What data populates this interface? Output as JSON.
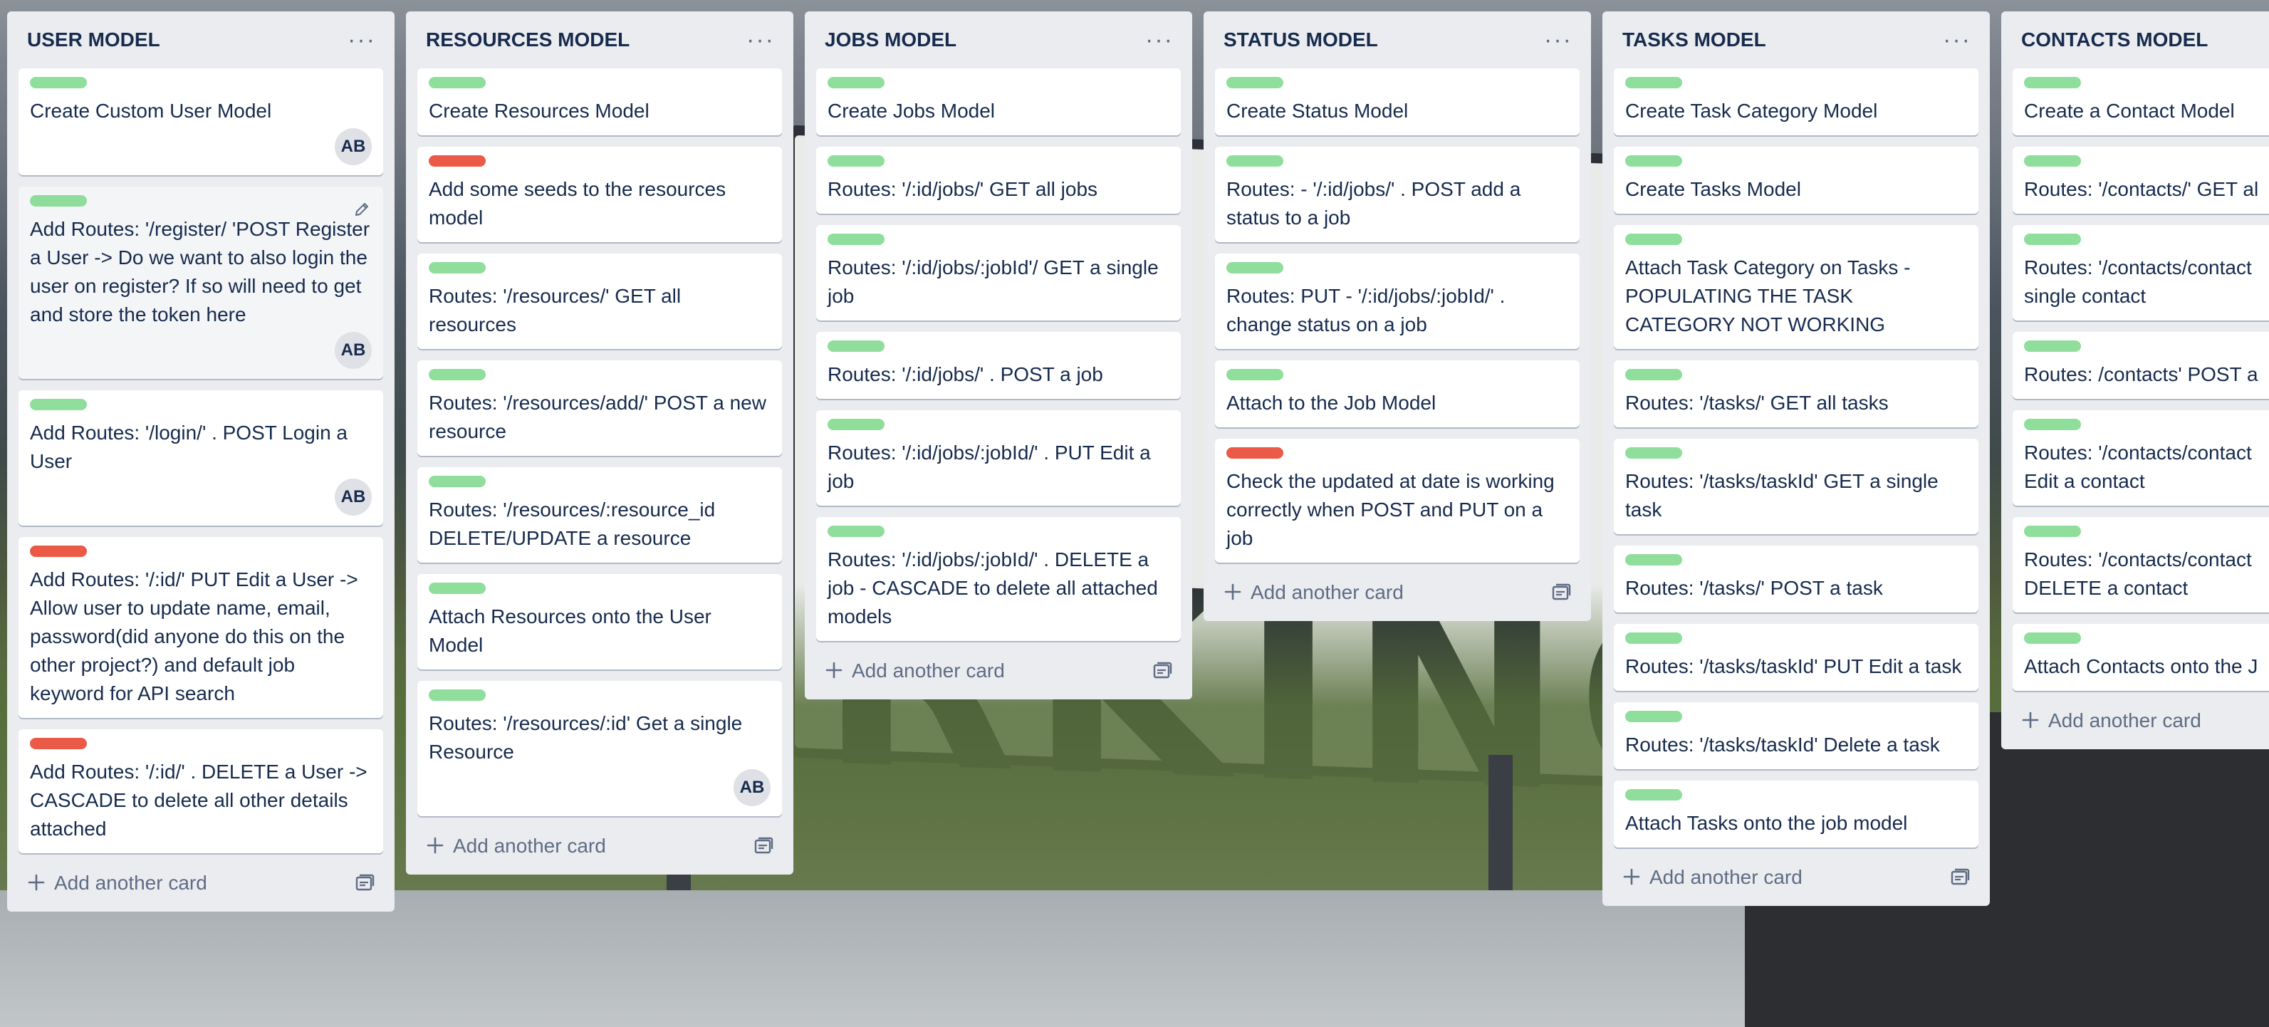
{
  "colors": {
    "label_green": "#7bd88a",
    "label_red": "#eb5a46",
    "list_bg": "#ebecf0"
  },
  "add_card_label": "Add another card",
  "lists": [
    {
      "title": "USER MODEL",
      "cards": [
        {
          "label": "green",
          "title": "Create Custom User Model",
          "member": "AB"
        },
        {
          "label": "green",
          "title": "Add Routes: '/register/ 'POST Register a User -> Do we want to also login the user on register? If so will need to get and store the token here",
          "member": "AB",
          "editing": true
        },
        {
          "label": "green",
          "title": "Add Routes: '/login/' . POST Login a User",
          "member": "AB"
        },
        {
          "label": "red",
          "title": "Add Routes: '/:id/' PUT Edit a User -> Allow user to update name, email, password(did anyone do this on the other project?) and default job keyword for API search"
        },
        {
          "label": "red",
          "title": "Add Routes: '/:id/' . DELETE a User -> CASCADE to delete all other details attached"
        }
      ]
    },
    {
      "title": "RESOURCES MODEL",
      "cards": [
        {
          "label": "green",
          "title": "Create Resources Model"
        },
        {
          "label": "red",
          "title": "Add some seeds to the resources model"
        },
        {
          "label": "green",
          "title": "Routes: '/resources/' GET all resources"
        },
        {
          "label": "green",
          "title": "Routes: '/resources/add/' POST a new resource"
        },
        {
          "label": "green",
          "title": "Routes: '/resources/:resource_id DELETE/UPDATE a resource"
        },
        {
          "label": "green",
          "title": "Attach Resources onto the User Model"
        },
        {
          "label": "green",
          "title": "Routes: '/resources/:id' Get a single Resource",
          "member": "AB"
        }
      ]
    },
    {
      "title": "JOBS MODEL",
      "cards": [
        {
          "label": "green",
          "title": "Create Jobs Model"
        },
        {
          "label": "green",
          "title": "Routes: '/:id/jobs/' GET all jobs"
        },
        {
          "label": "green",
          "title": "Routes: '/:id/jobs/:jobId'/ GET a single job"
        },
        {
          "label": "green",
          "title": "Routes: '/:id/jobs/' . POST a job"
        },
        {
          "label": "green",
          "title": "Routes: '/:id/jobs/:jobId/' . PUT Edit a job"
        },
        {
          "label": "green",
          "title": "Routes: '/:id/jobs/:jobId/' . DELETE a job - CASCADE to delete all attached models"
        }
      ]
    },
    {
      "title": "STATUS MODEL",
      "cards": [
        {
          "label": "green",
          "title": "Create Status Model"
        },
        {
          "label": "green",
          "title": "Routes: - '/:id/jobs/' . POST add a status to a job"
        },
        {
          "label": "green",
          "title": "Routes: PUT - '/:id/jobs/:jobId/' . change status on a job"
        },
        {
          "label": "green",
          "title": "Attach to the Job Model"
        },
        {
          "label": "red",
          "title": "Check the updated at date is working correctly when POST and PUT on a job"
        }
      ]
    },
    {
      "title": "TASKS MODEL",
      "cards": [
        {
          "label": "green",
          "title": "Create Task Category Model"
        },
        {
          "label": "green",
          "title": "Create Tasks Model"
        },
        {
          "label": "green",
          "title": "Attach Task Category on Tasks - POPULATING THE TASK CATEGORY NOT WORKING"
        },
        {
          "label": "green",
          "title": "Routes: '/tasks/' GET all tasks"
        },
        {
          "label": "green",
          "title": "Routes: '/tasks/taskId' GET a single task"
        },
        {
          "label": "green",
          "title": "Routes: '/tasks/' POST a task"
        },
        {
          "label": "green",
          "title": "Routes: '/tasks/taskId' PUT Edit a task"
        },
        {
          "label": "green",
          "title": "Routes: '/tasks/taskId' Delete a task"
        },
        {
          "label": "green",
          "title": "Attach Tasks onto the job model"
        }
      ]
    },
    {
      "title": "CONTACTS MODEL",
      "clipped": true,
      "cards": [
        {
          "label": "green",
          "title": "Create a Contact Model"
        },
        {
          "label": "green",
          "title": "Routes: '/contacts/' GET al"
        },
        {
          "label": "green",
          "title": "Routes: '/contacts/contact",
          "title2": "single contact"
        },
        {
          "label": "green",
          "title": "Routes: /contacts' POST a"
        },
        {
          "label": "green",
          "title": "Routes: '/contacts/contact",
          "title2": "Edit a contact"
        },
        {
          "label": "green",
          "title": "Routes: '/contacts/contact",
          "title2": "DELETE a contact"
        },
        {
          "label": "green",
          "title": "Attach Contacts onto the J"
        }
      ]
    }
  ]
}
